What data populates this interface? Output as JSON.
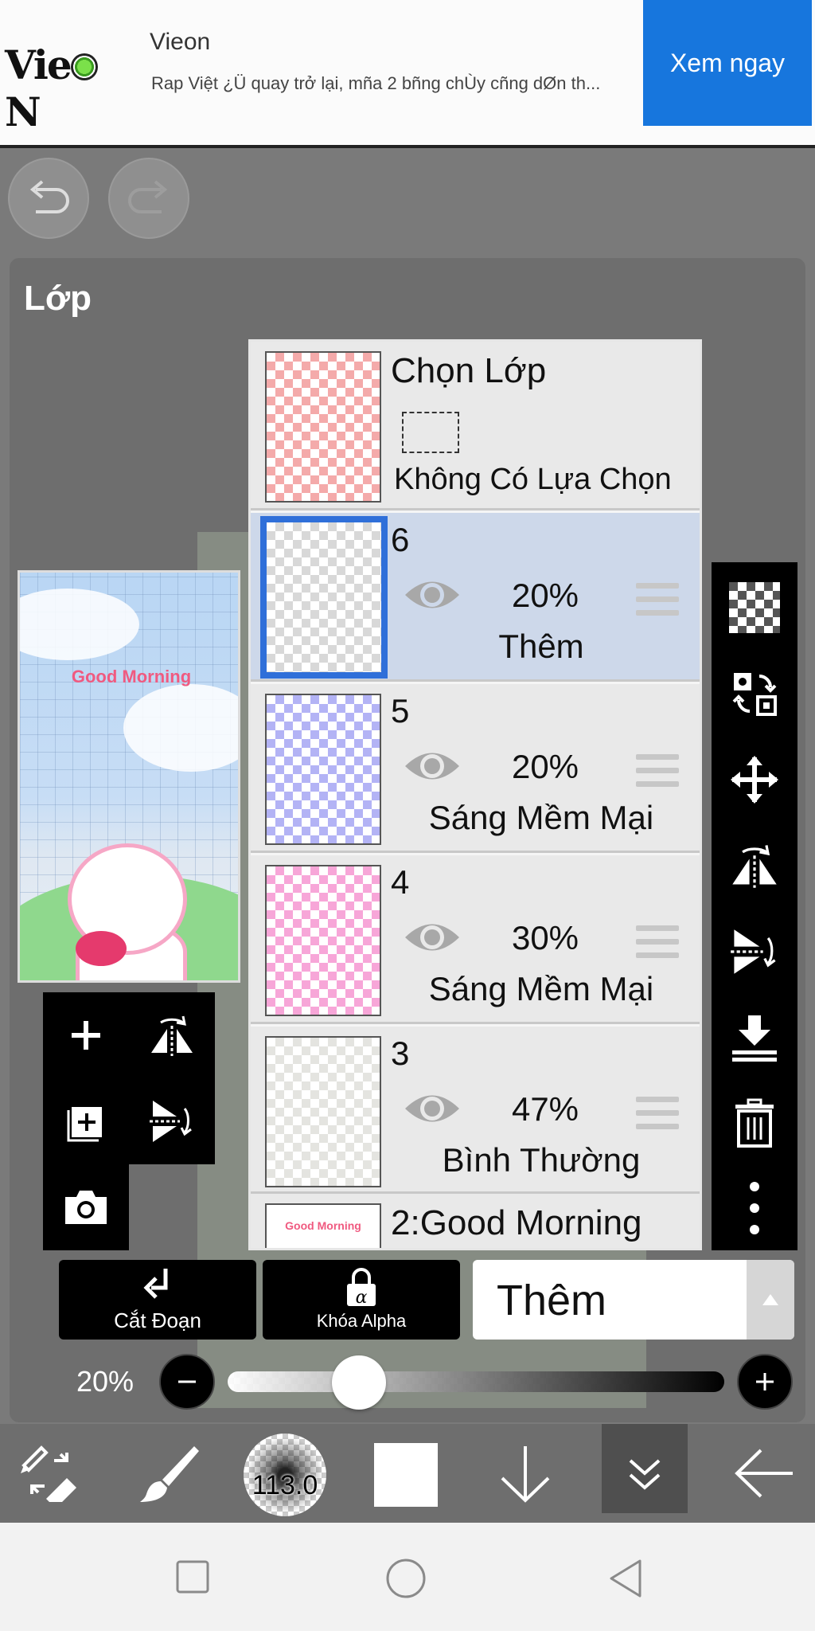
{
  "ad": {
    "brand": "Vieon",
    "logo_left": "Vie",
    "logo_right": "N",
    "description": "Rap Việt ¿Ü quay trở lại, mña 2 bñng chÙy cñng dØn th...",
    "cta": "Xem ngay",
    "cta_color": "#1776dd"
  },
  "panel": {
    "title": "Lớp"
  },
  "thumbnail": {
    "text": "Good Morning"
  },
  "selection": {
    "title": "Chọn Lớp",
    "status": "Không Có Lựa Chọn"
  },
  "layers": [
    {
      "number": "6",
      "opacity": "20%",
      "blend": "Thêm",
      "selected": true,
      "swatch": "#ffffff"
    },
    {
      "number": "5",
      "opacity": "20%",
      "blend": "Sáng Mềm Mại",
      "selected": false,
      "swatch": "#b3b3f5"
    },
    {
      "number": "4",
      "opacity": "30%",
      "blend": "Sáng Mềm Mại",
      "selected": false,
      "swatch": "#f7a6d8"
    },
    {
      "number": "3",
      "opacity": "47%",
      "blend": "Bình Thường",
      "selected": false,
      "swatch": "#f0f0ec"
    }
  ],
  "layer2": {
    "name": "2:Good Morning",
    "thumb_text": "Good Morning"
  },
  "controls": {
    "clipping": "Cắt Đoạn",
    "alpha_lock": "Khóa Alpha",
    "blend_mode": "Thêm",
    "opacity_label": "20%",
    "opacity_value": 0.2
  },
  "toolbar": {
    "brush_size": "113.0",
    "color": "#ffffff"
  },
  "colors": {
    "selected_layer_bg": "#cdd8ea",
    "selected_border": "#2f6fd9",
    "panel_bg": "#6e6e6e"
  }
}
